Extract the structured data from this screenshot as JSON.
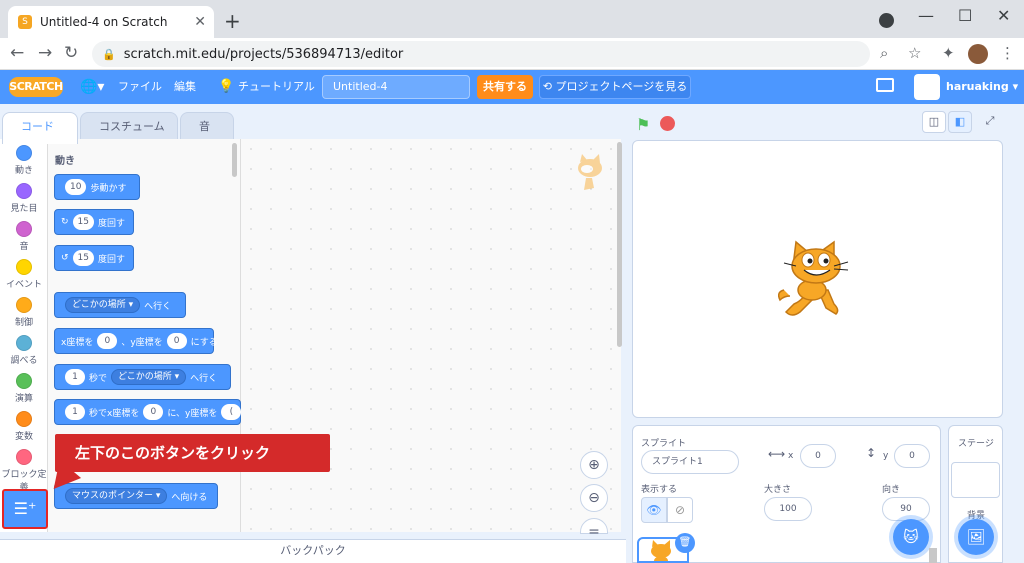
{
  "browser": {
    "tab_title": "Untitled-4 on Scratch",
    "url": "scratch.mit.edu/projects/536894713/editor"
  },
  "menubar": {
    "logo": "SCRATCH",
    "file": "ファイル",
    "edit": "編集",
    "tutorial": "チュートリアル",
    "project_title": "Untitled-4",
    "share": "共有する",
    "project_page": "プロジェクトページを見る",
    "username": "haruaking"
  },
  "editor_tabs": [
    "コード",
    "コスチューム",
    "音"
  ],
  "categories": [
    {
      "label": "動き",
      "color": "#4c97ff"
    },
    {
      "label": "見た目",
      "color": "#9966ff"
    },
    {
      "label": "音",
      "color": "#cf63cf"
    },
    {
      "label": "イベント",
      "color": "#ffd500"
    },
    {
      "label": "制御",
      "color": "#ffab19"
    },
    {
      "label": "調べる",
      "color": "#5cb1d6"
    },
    {
      "label": "演算",
      "color": "#59c059"
    },
    {
      "label": "変数",
      "color": "#ff8c1a"
    },
    {
      "label": "ブロック定義",
      "color": "#ff6680"
    }
  ],
  "palette": {
    "title": "動き",
    "move": {
      "value": "10",
      "text": "歩動かす"
    },
    "turn_right": {
      "value": "15",
      "text": "度回す"
    },
    "turn_left": {
      "value": "15",
      "text": "度回す"
    },
    "goto": {
      "dropdown": "どこかの場所",
      "text": "へ行く"
    },
    "goto_xy": {
      "xlabel": "x座標を",
      "x": "0",
      "sep": "、y座標を",
      "y": "0",
      "text": "にする"
    },
    "glide": {
      "value": "1",
      "text1": "秒で",
      "dropdown": "どこかの場所",
      "text2": "へ行く"
    },
    "glide_xy": {
      "value": "1",
      "text1": "秒でx座標を",
      "x": "0",
      "text2": "に、y座標を",
      "y": "("
    },
    "point_towards": {
      "dropdown": "マウスのポインター",
      "text": "へ向ける"
    }
  },
  "callout": "左下のこのボタンをクリック",
  "backpack": "バックパック",
  "sprite_panel": {
    "sprite_label": "スプライト",
    "sprite_name": "スプライト1",
    "x_label": "x",
    "x_value": "0",
    "y_label": "y",
    "y_value": "0",
    "show_label": "表示する",
    "size_label": "大きさ",
    "size_value": "100",
    "direction_label": "向き",
    "direction_value": "90"
  },
  "stage_panel": {
    "label": "ステージ",
    "backdrop_label": "背景"
  }
}
